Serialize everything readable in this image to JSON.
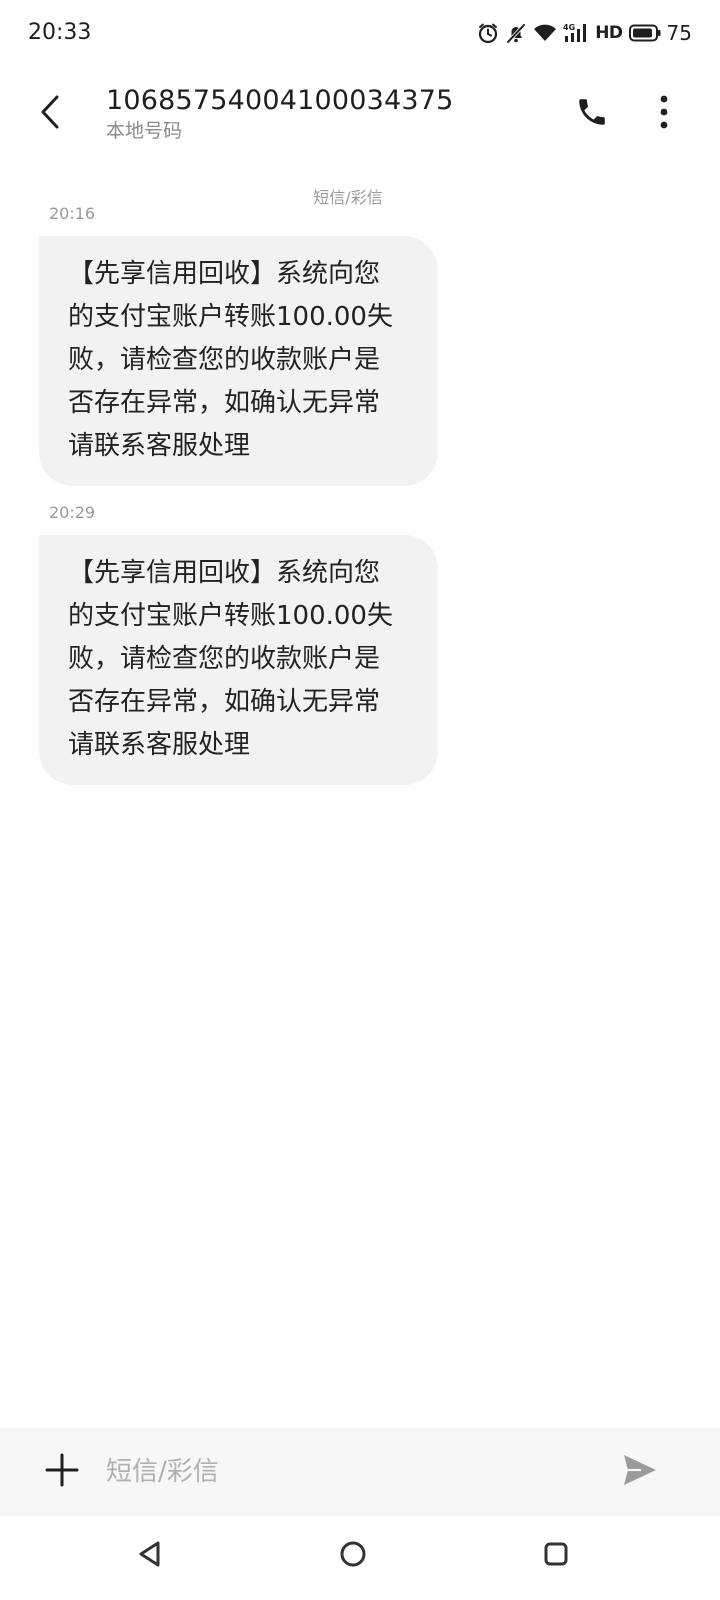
{
  "status_bar": {
    "time": "20:33",
    "network_label": "HD",
    "battery_level": "75",
    "icons": [
      "alarm-icon",
      "mute-bell-icon",
      "wifi-icon",
      "signal-4g-icon",
      "battery-icon"
    ]
  },
  "header": {
    "contact_number": "10685754004100034375",
    "contact_subtitle": "本地号码",
    "icons": {
      "back": "chevron-left-icon",
      "call": "phone-icon",
      "more": "more-vertical-icon"
    }
  },
  "conversation": {
    "channel_label": "短信/彩信",
    "messages": [
      {
        "time": "20:16",
        "text": "【先享信用回收】系统向您\n的支付宝账户转账100.00失\n败，请检查您的收款账户是\n否存在异常，如确认无异常\n请联系客服处理"
      },
      {
        "time": "20:29",
        "text": "【先享信用回收】系统向您\n的支付宝账户转账100.00失\n败，请检查您的收款账户是\n否存在异常，如确认无异常\n请联系客服处理"
      }
    ]
  },
  "composer": {
    "placeholder": "短信/彩信",
    "value": "",
    "icons": {
      "add": "plus-icon",
      "send": "send-icon"
    }
  },
  "nav": {
    "icons": [
      "nav-back-icon",
      "nav-home-icon",
      "nav-recents-icon"
    ]
  },
  "colors": {
    "background": "#ffffff",
    "bubble": "#f2f2f2",
    "secondary_text": "#9a9a9a",
    "input_bar": "#f7f7f7"
  }
}
